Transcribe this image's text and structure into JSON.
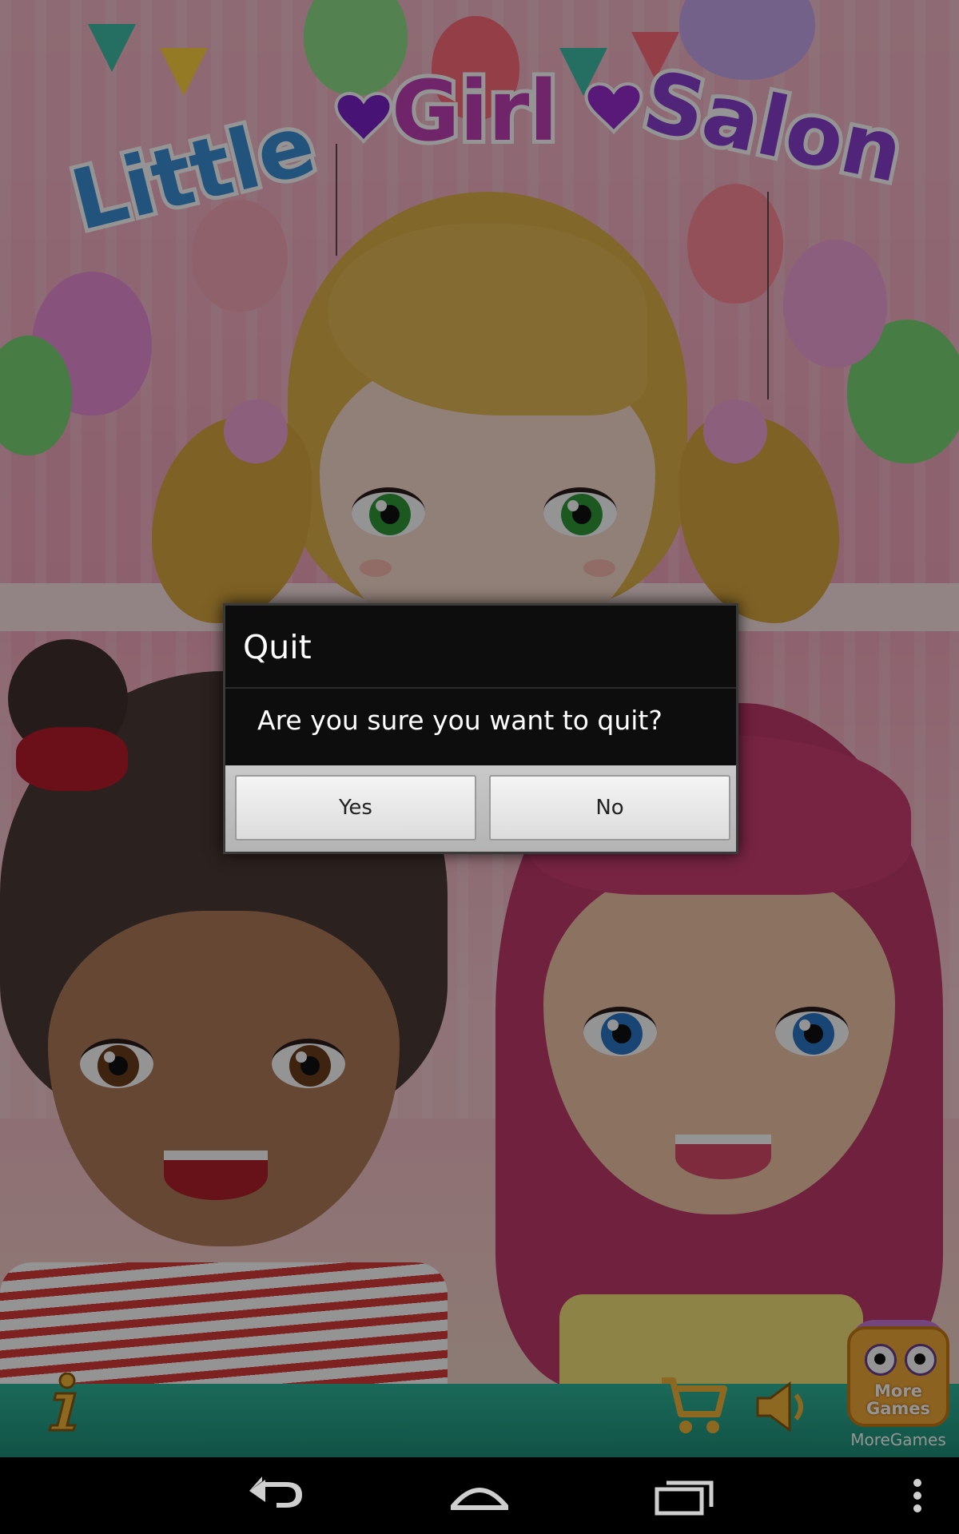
{
  "game": {
    "title_words": [
      "Little",
      "Girl",
      "Salon"
    ],
    "more_games_label": "More\nGames",
    "more_games_caption": "MoreGames",
    "bottom_icons": [
      "info-icon",
      "cart-icon",
      "speaker-icon"
    ]
  },
  "dialog": {
    "title": "Quit",
    "message": "Are you sure you want to quit?",
    "yes_label": "Yes",
    "no_label": "No"
  },
  "navbar": {
    "buttons": [
      "back-icon",
      "home-icon",
      "recent-apps-icon",
      "overflow-menu-icon"
    ]
  },
  "colors": {
    "title_blue": "#3a8fd8",
    "title_magenta": "#c23fb6",
    "title_purple": "#8b3fcf",
    "dialog_bg": "#0d0d0d",
    "button_face": "#e6e6e6"
  }
}
